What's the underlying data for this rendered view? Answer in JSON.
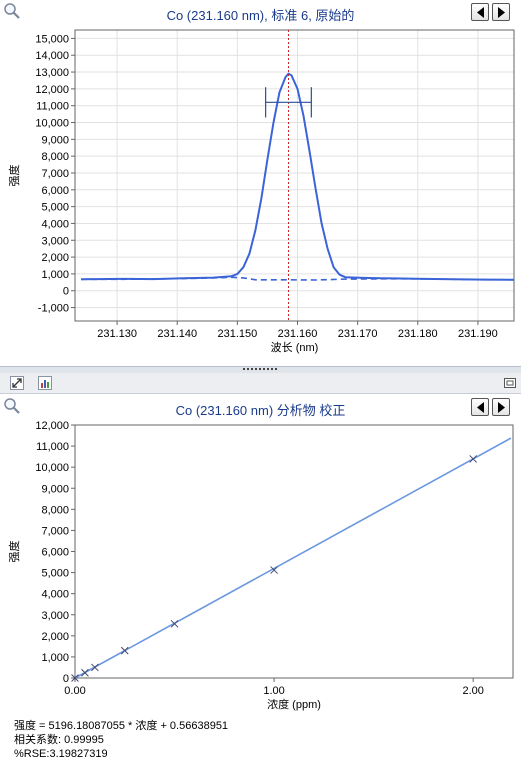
{
  "top_panel": {
    "title": "Co  (231.160  nm), 标准 6, 原始的",
    "zoom_icon": "magnifier-icon",
    "prev_icon": "arrow-left-icon",
    "next_icon": "arrow-right-icon"
  },
  "toolbar": {
    "expand_icon": "expand-icon",
    "chart_icon": "chart-options-icon",
    "restore_icon": "restore-window-icon"
  },
  "bottom_panel": {
    "title": "Co  (231.160  nm) 分析物  校正",
    "zoom_icon": "magnifier-icon",
    "prev_icon": "arrow-left-icon",
    "next_icon": "arrow-right-icon"
  },
  "stats": {
    "equation": "强度 = 5196.18087055 * 浓度 + 0.56638951",
    "correlation": "相关系数: 0.99995",
    "rse": "%RSE:3.19827319"
  },
  "colors": {
    "line": "#3a64d8",
    "fit": "#6a98e0",
    "marker": "#404870",
    "vline": "#cc2222",
    "axis": "#666666",
    "grid": "#e2e2e2",
    "title": "#1a3a8c"
  },
  "chart_data": [
    {
      "type": "line",
      "title": "Co  (231.160  nm), 标准 6, 原始的",
      "xlabel": "波长 (nm)",
      "ylabel": "强度",
      "xlim": [
        231.123,
        231.196
      ],
      "ylim": [
        -1800,
        15500
      ],
      "xticks": [
        231.13,
        231.14,
        231.15,
        231.16,
        231.17,
        231.18,
        231.19
      ],
      "xtick_labels": [
        "231.130",
        "231.140",
        "231.150",
        "231.160",
        "231.170",
        "231.180",
        "231.190"
      ],
      "yticks": [
        -1000,
        0,
        1000,
        2000,
        3000,
        4000,
        5000,
        6000,
        7000,
        8000,
        9000,
        10000,
        11000,
        12000,
        13000,
        14000,
        15000
      ],
      "ytick_labels": [
        "-1,000",
        "0",
        "1,000",
        "2,000",
        "3,000",
        "4,000",
        "5,000",
        "6,000",
        "7,000",
        "8,000",
        "9,000",
        "10,000",
        "11,000",
        "12,000",
        "13,000",
        "14,000",
        "15,000"
      ],
      "grid": true,
      "peak_line_x": 231.1585,
      "window": {
        "x_start": 231.1547,
        "x_end": 231.1623,
        "y": 11200,
        "cap_half_height": 900
      },
      "series": [
        {
          "style": "solid",
          "x": [
            231.124,
            231.131,
            231.136,
            231.141,
            231.146,
            231.149,
            231.15,
            231.151,
            231.152,
            231.153,
            231.154,
            231.155,
            231.156,
            231.157,
            231.158,
            231.1585,
            231.159,
            231.16,
            231.161,
            231.162,
            231.163,
            231.164,
            231.165,
            231.166,
            231.167,
            231.168,
            231.171,
            231.176,
            231.181,
            231.186,
            231.191,
            231.196
          ],
          "y": [
            680,
            700,
            690,
            740,
            780,
            860,
            1000,
            1400,
            2200,
            3600,
            5500,
            7800,
            10000,
            11800,
            12700,
            12900,
            12800,
            12000,
            10400,
            8300,
            6100,
            4000,
            2500,
            1400,
            950,
            800,
            760,
            730,
            700,
            680,
            660,
            650
          ]
        },
        {
          "style": "dashed",
          "x": [
            231.124,
            231.131,
            231.141,
            231.146,
            231.149,
            231.151,
            231.153,
            231.158,
            231.163,
            231.168,
            231.176,
            231.181,
            231.186,
            231.191,
            231.196
          ],
          "y": [
            680,
            680,
            720,
            760,
            800,
            760,
            650,
            650,
            640,
            690,
            710,
            700,
            680,
            660,
            650
          ]
        }
      ]
    },
    {
      "type": "scatter",
      "title": "Co  (231.160  nm) 分析物  校正",
      "xlabel": "浓度 (ppm)",
      "ylabel": "强度",
      "xlim": [
        0,
        2.2
      ],
      "ylim": [
        0,
        12000
      ],
      "xticks": [
        0,
        1,
        2
      ],
      "xtick_labels": [
        "0.00",
        "1.00",
        "2.00"
      ],
      "yticks": [
        0,
        1000,
        2000,
        3000,
        4000,
        5000,
        6000,
        7000,
        8000,
        9000,
        10000,
        11000,
        12000
      ],
      "ytick_labels": [
        "0",
        "1,000",
        "2,000",
        "3,000",
        "4,000",
        "5,000",
        "6,000",
        "7,000",
        "8,000",
        "9,000",
        "10,000",
        "11,000",
        "12,000"
      ],
      "grid": false,
      "points": {
        "x": [
          0,
          0.05,
          0.1,
          0.25,
          0.5,
          1.0,
          2.0
        ],
        "y": [
          0,
          250,
          500,
          1300,
          2570,
          5120,
          10390
        ]
      },
      "fit": {
        "slope": 5196.18087055,
        "intercept": 0.56638951,
        "x_end": 2.19
      }
    }
  ]
}
